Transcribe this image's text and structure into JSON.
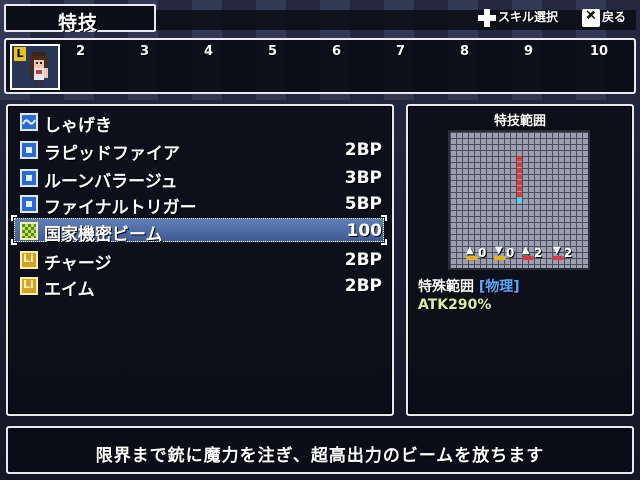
{
  "menu": {
    "title": "特技",
    "hints": [
      {
        "icon": "dpad-icon",
        "label": "スキル選択"
      },
      {
        "icon": "x-button-icon",
        "label": "戻る"
      }
    ]
  },
  "party": {
    "selected_badge": "L",
    "slots": [
      "2",
      "3",
      "4",
      "5",
      "6",
      "7",
      "8",
      "9",
      "10"
    ]
  },
  "skills": [
    {
      "name": "しゃげき",
      "cost": "",
      "icon": "wave-blue"
    },
    {
      "name": "ラピッドファイア",
      "cost": "2BP",
      "icon": "square-blue"
    },
    {
      "name": "ルーンバラージュ",
      "cost": "3BP",
      "icon": "square-blue"
    },
    {
      "name": "ファイナルトリガー",
      "cost": "5BP",
      "icon": "square-blue"
    },
    {
      "name": "国家機密ビーム",
      "cost": "100",
      "icon": "checker-gold",
      "selected": true
    },
    {
      "name": "チャージ",
      "cost": "2BP",
      "icon": "gold-li"
    },
    {
      "name": "エイム",
      "cost": "2BP",
      "icon": "gold-li"
    }
  ],
  "range_panel": {
    "title": "特技範囲",
    "stats": [
      "0",
      "0",
      "2",
      "2"
    ],
    "range_type": "特殊範囲",
    "attribute": "[物理]",
    "power": "ATK290%"
  },
  "description": "限界まで銃に魔力を注ぎ、超高出力のビームを放ちます",
  "colors": {
    "attribute": "#5aa8ff",
    "power": "#d8f0a0",
    "range_marker": "#e03a3a",
    "origin_marker": "#40d8f0"
  }
}
